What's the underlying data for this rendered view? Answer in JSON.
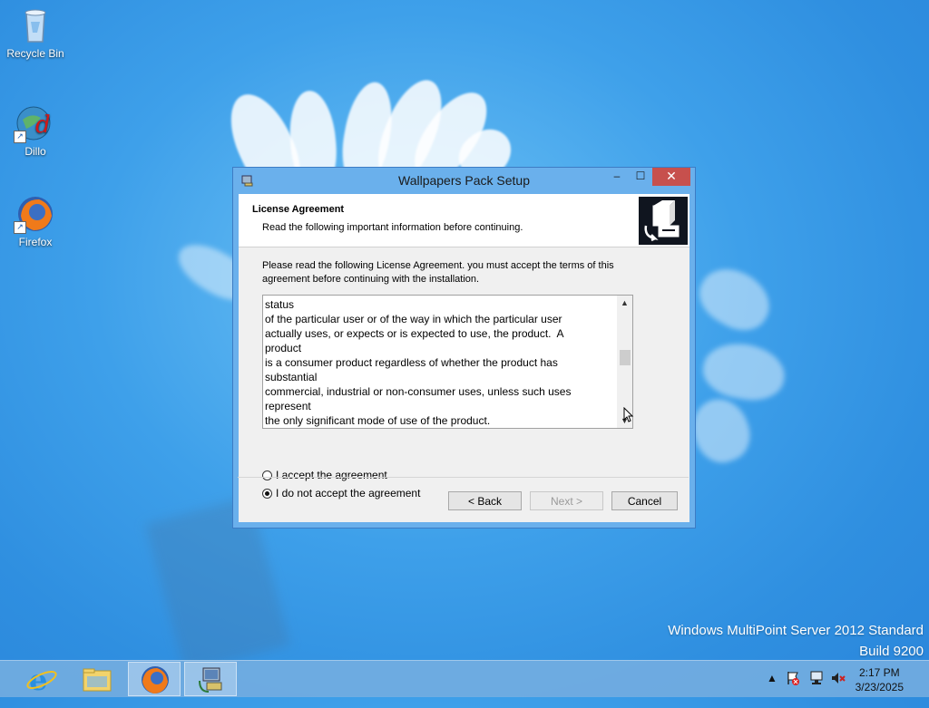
{
  "desktop": {
    "icons": [
      {
        "label": "Recycle Bin",
        "icon": "recycle-bin-icon"
      },
      {
        "label": "Dillo",
        "icon": "dillo-icon"
      },
      {
        "label": "Firefox",
        "icon": "firefox-icon"
      }
    ],
    "watermark": {
      "line1": "Windows MultiPoint Server 2012 Standard",
      "line2": "Build 9200"
    }
  },
  "window": {
    "title": "Wallpapers Pack  Setup",
    "controls": {
      "minimize": "–",
      "maximize": "☐",
      "close": "✕"
    },
    "header": {
      "title": "License Agreement",
      "subtitle": "Read the following important information before continuing."
    },
    "intro": "Please read the following License Agreement. you must accept the terms of this agreement before continuing with the installation.",
    "license_lines": "status\nof the particular user or of the way in which the particular user\nactually uses, or expects or is expected to use, the product.  A\nproduct\nis a consumer product regardless of whether the product has\nsubstantial\ncommercial, industrial or non-consumer uses, unless such uses\nrepresent\nthe only significant mode of use of the product.",
    "options": {
      "accept": "I accept the agreement",
      "decline": "I do not accept the agreement",
      "selected": "decline"
    },
    "buttons": {
      "back": "< Back",
      "next": "Next >",
      "cancel": "Cancel"
    }
  },
  "taskbar": {
    "apps": [
      "internet-explorer-icon",
      "file-explorer-icon",
      "firefox-icon",
      "setup-icon"
    ],
    "clock": {
      "time": "2:17 PM",
      "date": "3/23/2025"
    }
  },
  "colors": {
    "close_button": "#c7504d",
    "window_frame": "#6ab0ec"
  }
}
